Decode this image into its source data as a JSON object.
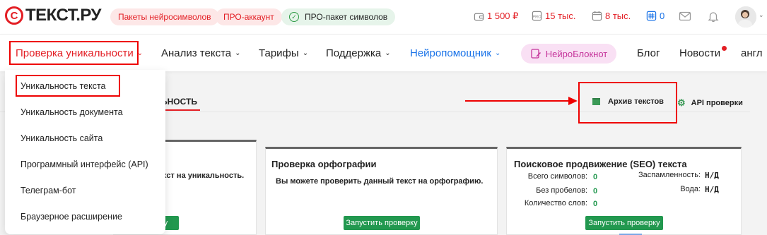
{
  "header": {
    "logo_letter": "С",
    "logo_text": "ТЕКСТ.РУ",
    "pills": [
      "Пакеты нейросимволов",
      "ПРО-аккаунт",
      "ПРО-пакет символов"
    ],
    "balance": "1 500 ₽",
    "pro_symbols": "15 тыс.",
    "days_symbols": "8 тыс.",
    "hash_count": "0"
  },
  "nav": {
    "items": [
      "Проверка уникальности",
      "Анализ текста",
      "Тарифы",
      "Поддержка",
      "Нейропомощник",
      "НейроБлокнот",
      "Блог",
      "Новости",
      "англ"
    ]
  },
  "dropdown": {
    "items": [
      "Уникальность текста",
      "Уникальность документа",
      "Уникальность сайта",
      "Программный интерфейс (API)",
      "Телеграм-бот",
      "Браузерное расширение"
    ]
  },
  "tabs": {
    "active_fragment": "ЬНОСТЬ",
    "archive_label": "Архив текстов",
    "api_label": "API проверки"
  },
  "cards": {
    "unique": {
      "text_fragment": "кст на уникальность.",
      "button_fragment": "рку"
    },
    "spelling": {
      "title": "Проверка орфографии",
      "text": "Вы можете проверить данный текст на орфографию.",
      "button": "Запустить проверку"
    },
    "seo": {
      "title": "Поисковое продвижение (SEO) текста",
      "left_labels": [
        "Всего символов:",
        "Без пробелов:",
        "Количество слов:"
      ],
      "left_values": [
        "0",
        "0",
        "0"
      ],
      "right_labels": [
        "Заспамленность:",
        "Вода:"
      ],
      "right_values": [
        "Н/Д",
        "Н/Д"
      ],
      "button": "Запустить проверку"
    }
  },
  "colors": {
    "brand_red": "#e31e24",
    "accent_green": "#22984f",
    "link_blue": "#1a73e8"
  }
}
